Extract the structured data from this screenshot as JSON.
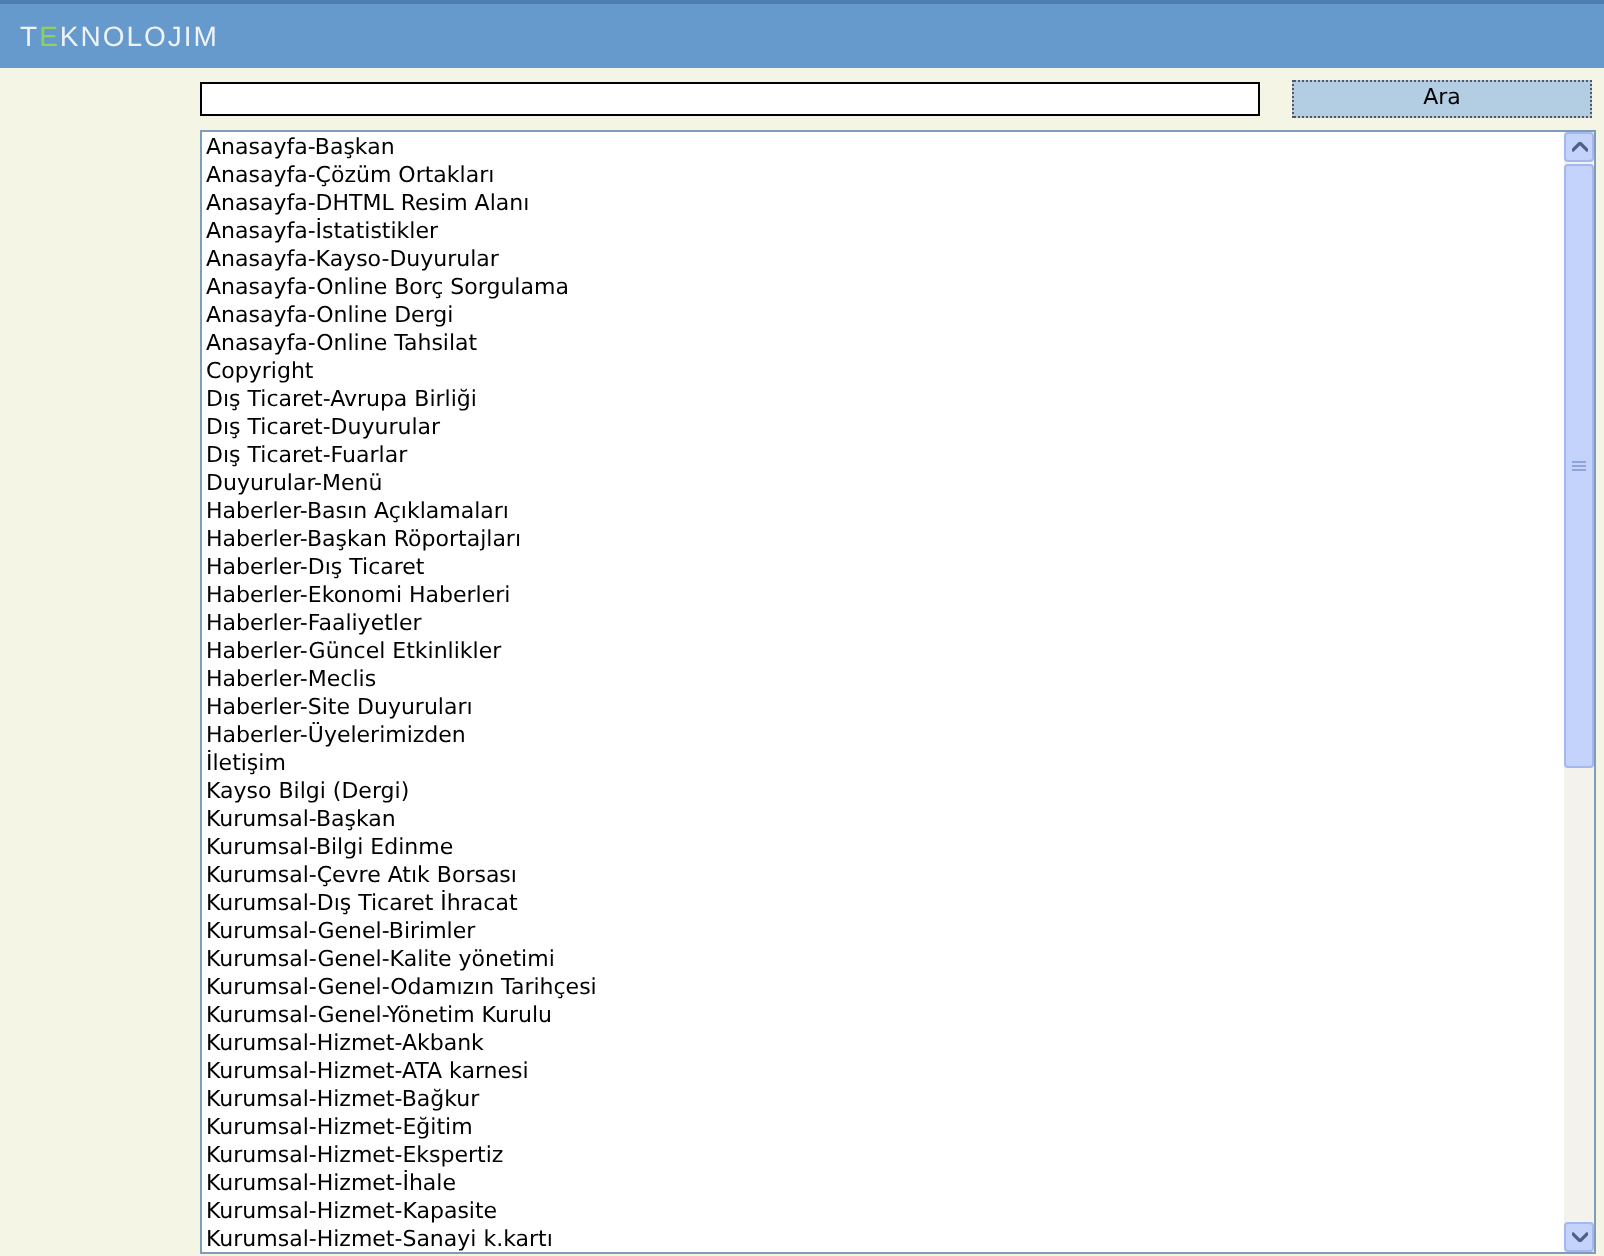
{
  "header": {
    "logo": [
      {
        "text": "T",
        "accent": false
      },
      {
        "text": "E",
        "accent": true
      },
      {
        "text": "KNOLOJIM",
        "accent": false
      }
    ]
  },
  "search": {
    "button": "Ara"
  },
  "list": {
    "items": [
      "Anasayfa-Başkan",
      "Anasayfa-Çözüm Ortakları",
      "Anasayfa-DHTML Resim Alanı",
      "Anasayfa-İstatistikler",
      "Anasayfa-Kayso-Duyurular",
      "Anasayfa-Online Borç Sorgulama",
      "Anasayfa-Online Dergi",
      "Anasayfa-Online Tahsilat",
      "Copyright",
      "Dış Ticaret-Avrupa Birliği",
      "Dış Ticaret-Duyurular",
      "Dış Ticaret-Fuarlar",
      "Duyurular-Menü",
      "Haberler-Basın Açıklamaları",
      "Haberler-Başkan Röportajları",
      "Haberler-Dış Ticaret",
      "Haberler-Ekonomi Haberleri",
      "Haberler-Faaliyetler",
      "Haberler-Güncel Etkinlikler",
      "Haberler-Meclis",
      "Haberler-Site Duyuruları",
      "Haberler-Üyelerimizden",
      "İletişim",
      "Kayso Bilgi (Dergi)",
      "Kurumsal-Başkan",
      "Kurumsal-Bilgi Edinme",
      "Kurumsal-Çevre Atık Borsası",
      "Kurumsal-Dış Ticaret İhracat",
      "Kurumsal-Genel-Birimler",
      "Kurumsal-Genel-Kalite yönetimi",
      "Kurumsal-Genel-Odamızın Tarihçesi",
      "Kurumsal-Genel-Yönetim Kurulu",
      "Kurumsal-Hizmet-Akbank",
      "Kurumsal-Hizmet-ATA karnesi",
      "Kurumsal-Hizmet-Bağkur",
      "Kurumsal-Hizmet-Eğitim",
      "Kurumsal-Hizmet-Ekspertiz",
      "Kurumsal-Hizmet-İhale",
      "Kurumsal-Hizmet-Kapasite",
      "Kurumsal-Hizmet-Sanayi k.kartı"
    ]
  }
}
